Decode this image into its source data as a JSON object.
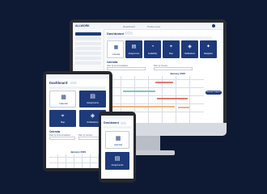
{
  "monitor": {
    "logo": "ALLWORK",
    "nav": [
      "Dashboard",
      "Preferences"
    ],
    "title": "Dashboard",
    "tiles": [
      {
        "label": "Calendar",
        "icon": "calendar-icon",
        "style": "white"
      },
      {
        "label": "Assignments",
        "icon": "assignments-icon",
        "style": "dark"
      },
      {
        "label": "Availability",
        "icon": "availability-icon",
        "style": "dark"
      },
      {
        "label": "Map",
        "icon": "map-icon",
        "style": "dark"
      },
      {
        "label": "Notifications",
        "icon": "notifications-icon",
        "style": "dark"
      },
      {
        "label": "Navigation",
        "icon": "navigation-icon",
        "style": "dark"
      }
    ],
    "calendar_title": "Calendar",
    "filter1": "Filter by Accommodation",
    "filter2": "Filter by Service",
    "month": "January 2026",
    "request_button": "Request Support"
  },
  "tablet": {
    "title": "Dashboard",
    "tiles": [
      {
        "label": "Calendar",
        "icon": "calendar-icon",
        "style": "white"
      },
      {
        "label": "Assignments",
        "icon": "assignments-icon",
        "style": "dark"
      },
      {
        "label": "Map",
        "icon": "map-icon",
        "style": "dark"
      },
      {
        "label": "Notifications",
        "icon": "notifications-icon",
        "style": "dark"
      }
    ],
    "calendar_title": "Calendar",
    "filter1": "Filter by Accommodation",
    "filter2": "Filter by Service",
    "month": "January 2026"
  },
  "phone": {
    "title": "Dashboard",
    "tiles": [
      {
        "label": "Calendar",
        "icon": "calendar-icon",
        "style": "white"
      },
      {
        "label": "Assignments",
        "icon": "assignments-icon",
        "style": "dark"
      }
    ]
  },
  "colors": {
    "background": "#0e1a33",
    "brand": "#1e3a7a",
    "event_orange": "#f0b27a",
    "event_red": "#e07b6a",
    "event_teal": "#7fc6c0"
  }
}
